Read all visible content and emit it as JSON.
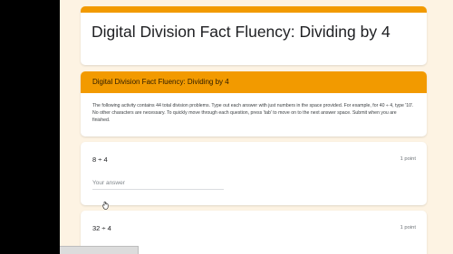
{
  "form": {
    "title": "Digital Division Fact Fluency: Dividing by 4"
  },
  "section": {
    "header": "Digital Division Fact Fluency: Dividing by 4",
    "description": "The following activity contains 44 total division problems. Type out each answer with just numbers in the space provided. For example, for 40 ÷ 4, type '10'. No other characters are necessary. To quickly move through each question, press 'tab' to move on to the next answer space. Submit when you are finished."
  },
  "questions": [
    {
      "text": "8 ÷ 4",
      "points": "1 point",
      "placeholder": "Your answer",
      "value": ""
    },
    {
      "text": "32 ÷ 4",
      "points": "1 point"
    }
  ],
  "colors": {
    "accent": "#f29a00",
    "page_background": "#fdf3e3"
  },
  "icons": [
    "mouse-cursor-icon"
  ]
}
